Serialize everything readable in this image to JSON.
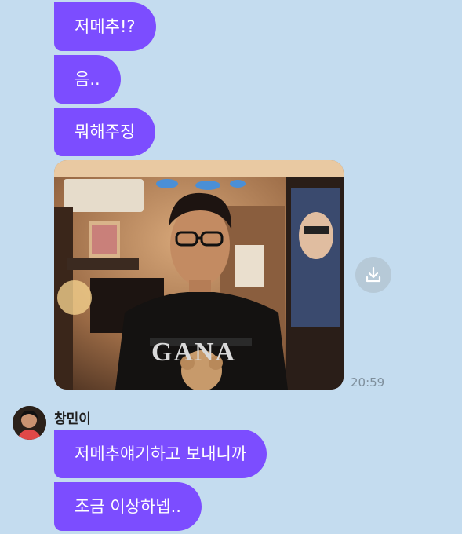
{
  "messages": [
    {
      "text": "저메추!?"
    },
    {
      "text": "음.."
    },
    {
      "text": "뭐해주징"
    }
  ],
  "photo_message": {
    "shirt_text": "GANA",
    "time": "20:59",
    "download_icon": "download-icon"
  },
  "sender": {
    "name": "창민이",
    "avatar": "avatar-photo"
  },
  "received": [
    {
      "text": "저메추얘기하고 보내니까"
    },
    {
      "text": "조금 이상하넵.."
    }
  ],
  "colors": {
    "background": "#c4dcef",
    "bubble": "#7c4dff",
    "download_button": "#b6c9d7"
  }
}
